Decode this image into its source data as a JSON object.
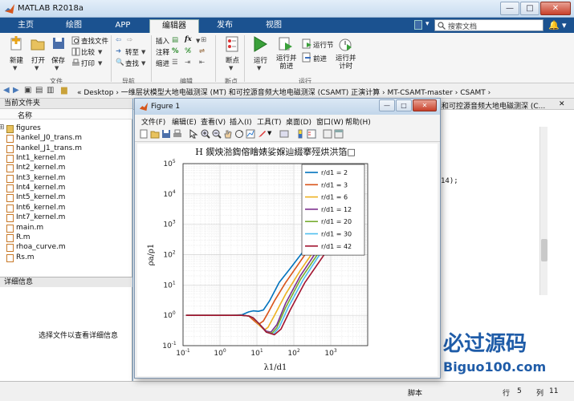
{
  "app": {
    "title": "MATLAB R2018a",
    "win_min": "—",
    "win_max": "□",
    "win_close": "✕"
  },
  "tabs": [
    "主页",
    "绘图",
    "APP",
    "编辑器",
    "发布",
    "视图"
  ],
  "search": {
    "placeholder": "搜索文档"
  },
  "ribbon": {
    "new": "新建",
    "open": "打开",
    "save": "保存",
    "find_file": "查找文件",
    "compare": "比较",
    "print": "打印",
    "goto": "转至",
    "find": "查找",
    "insert": "插入",
    "comment": "注释",
    "indent": "缩进",
    "fx": "fx",
    "breakpoints": "断点",
    "run": "运行",
    "run_advance": "运行并\n前进",
    "run_section": "运行节",
    "advance": "前进",
    "run_time": "运行并\n计时",
    "groups": {
      "file": "文件",
      "nav": "导航",
      "edit": "编辑",
      "bp": "断点",
      "run": "运行"
    }
  },
  "address": {
    "path": "« Desktop › 一维层状模型大地电磁测深 (MT) 和可控源音频大地电磁测深 (CSAMT) 正演计算 › MT-CSAMT-master › CSAMT ›"
  },
  "current_folder": {
    "title": "当前文件夹",
    "col_name": "名称",
    "items": [
      {
        "name": "figures",
        "type": "folder"
      },
      {
        "name": "hankel_J0_trans.m",
        "type": "m"
      },
      {
        "name": "hankel_J1_trans.m",
        "type": "m"
      },
      {
        "name": "Int1_kernel.m",
        "type": "m"
      },
      {
        "name": "Int2_kernel.m",
        "type": "m"
      },
      {
        "name": "Int3_kernel.m",
        "type": "m"
      },
      {
        "name": "Int4_kernel.m",
        "type": "m"
      },
      {
        "name": "Int5_kernel.m",
        "type": "m"
      },
      {
        "name": "Int6_kernel.m",
        "type": "m"
      },
      {
        "name": "Int7_kernel.m",
        "type": "m"
      },
      {
        "name": "main.m",
        "type": "m"
      },
      {
        "name": "R.m",
        "type": "m"
      },
      {
        "name": "rhoa_curve.m",
        "type": "m"
      },
      {
        "name": "Rs.m",
        "type": "m"
      }
    ]
  },
  "details": {
    "title": "详细信息",
    "message": "选择文件以查看详细信息"
  },
  "editor": {
    "tab_text": "和可控源音频大地电磁测深 (C...",
    "code_fragment": "14);"
  },
  "status": {
    "script": "脚本",
    "row_label": "行",
    "row": "5",
    "col_label": "列",
    "col": "11"
  },
  "figure": {
    "title": "Figure 1",
    "menus": [
      "文件(F)",
      "编辑(E)",
      "查看(V)",
      "插入(I)",
      "工具(T)",
      "桌面(D)",
      "窗口(W)",
      "帮助(H)"
    ]
  },
  "watermark": {
    "brand": "必过源码",
    "url": "Biguo100.com"
  },
  "colors": {
    "series": [
      "#0072BD",
      "#D95319",
      "#EDB120",
      "#7E2F8E",
      "#77AC30",
      "#4DBEEE",
      "#A2142F"
    ]
  },
  "chart_data": {
    "type": "line",
    "title": "H 鍥炴湁鍧傛瞺婊娑媬辿綴搴殌烘洪箔□",
    "xlabel": "λ1/d1",
    "ylabel": "ρa/ρ1",
    "xscale": "log",
    "yscale": "log",
    "xlim": [
      0.1,
      10000
    ],
    "ylim": [
      0.1,
      100000
    ],
    "xticks": [
      "10-1",
      "100",
      "101",
      "102",
      "103"
    ],
    "yticks": [
      "10-1",
      "100",
      "101",
      "102",
      "103",
      "104",
      "105"
    ],
    "grid": true,
    "legend_position": "top-right",
    "series": [
      {
        "name": "r/d1 = 2",
        "x": [
          0.12,
          0.5,
          2,
          4,
          6,
          8,
          11,
          15,
          22,
          40,
          80,
          200,
          600,
          2000,
          8000
        ],
        "y": [
          1,
          1,
          1,
          1.05,
          1.3,
          1.4,
          1.35,
          1.5,
          3,
          12,
          35,
          150,
          900,
          8000,
          80000
        ]
      },
      {
        "name": "r/d1 = 3",
        "x": [
          0.12,
          0.5,
          2,
          4,
          6,
          8,
          11,
          15,
          20,
          30,
          60,
          150,
          500,
          2000,
          8000
        ],
        "y": [
          1,
          1,
          1,
          1.0,
          0.95,
          0.7,
          0.5,
          0.65,
          1.2,
          3,
          12,
          60,
          500,
          5000,
          40000
        ]
      },
      {
        "name": "r/d1 = 6",
        "x": [
          0.12,
          0.5,
          2,
          4,
          6,
          8,
          12,
          16,
          20,
          30,
          60,
          150,
          500,
          2000,
          8000
        ],
        "y": [
          1,
          1,
          1,
          1.0,
          0.95,
          0.8,
          0.45,
          0.33,
          0.4,
          1,
          5,
          30,
          250,
          3000,
          20000
        ]
      },
      {
        "name": "r/d1 = 12",
        "x": [
          0.12,
          0.5,
          2,
          4,
          6,
          8,
          12,
          18,
          24,
          35,
          60,
          150,
          500,
          2000,
          8000
        ],
        "y": [
          1,
          1,
          1,
          1.0,
          0.95,
          0.82,
          0.5,
          0.3,
          0.28,
          0.5,
          2.5,
          20,
          180,
          2000,
          15000
        ]
      },
      {
        "name": "r/d1 = 20",
        "x": [
          0.12,
          0.5,
          2,
          4,
          6,
          8,
          12,
          18,
          26,
          35,
          60,
          150,
          500,
          2000,
          8000
        ],
        "y": [
          1,
          1,
          1,
          1.0,
          0.95,
          0.82,
          0.5,
          0.28,
          0.26,
          0.4,
          1.8,
          15,
          130,
          1500,
          10000
        ]
      },
      {
        "name": "r/d1 = 30",
        "x": [
          0.12,
          0.5,
          2,
          4,
          6,
          8,
          12,
          18,
          28,
          40,
          70,
          180,
          600,
          2000,
          8000
        ],
        "y": [
          1,
          1,
          1,
          1.0,
          0.95,
          0.82,
          0.5,
          0.28,
          0.24,
          0.4,
          1.8,
          15,
          140,
          1000,
          8000
        ]
      },
      {
        "name": "r/d1 = 42",
        "x": [
          0.12,
          0.5,
          2,
          4,
          6,
          8,
          12,
          18,
          30,
          45,
          80,
          200,
          700,
          2000,
          8000
        ],
        "y": [
          1,
          1,
          1,
          1.0,
          0.95,
          0.82,
          0.5,
          0.28,
          0.23,
          0.35,
          1.5,
          12,
          110,
          700,
          5000
        ]
      }
    ]
  }
}
